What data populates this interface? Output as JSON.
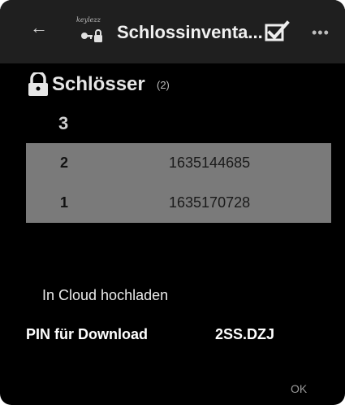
{
  "appbar": {
    "back_icon": "arrow-left-icon",
    "logo_text": "keylezz",
    "title": "Schlossinventa...",
    "check_icon": "check-square-icon",
    "more_icon": "more-dots-icon"
  },
  "section": {
    "title": "Schlösser",
    "count": "(2)",
    "header_value": "3"
  },
  "table": {
    "rows": [
      {
        "index": "2",
        "value": "1635144685"
      },
      {
        "index": "1",
        "value": "1635170728"
      }
    ]
  },
  "actions": {
    "upload_label": "In Cloud hochladen",
    "pin_label": "PIN für Download",
    "pin_value": "2SS.DZJ",
    "ok_label": "OK"
  },
  "colors": {
    "background": "#000000",
    "appbar": "#1f1f1f",
    "table_bg": "#7a7a7a"
  }
}
